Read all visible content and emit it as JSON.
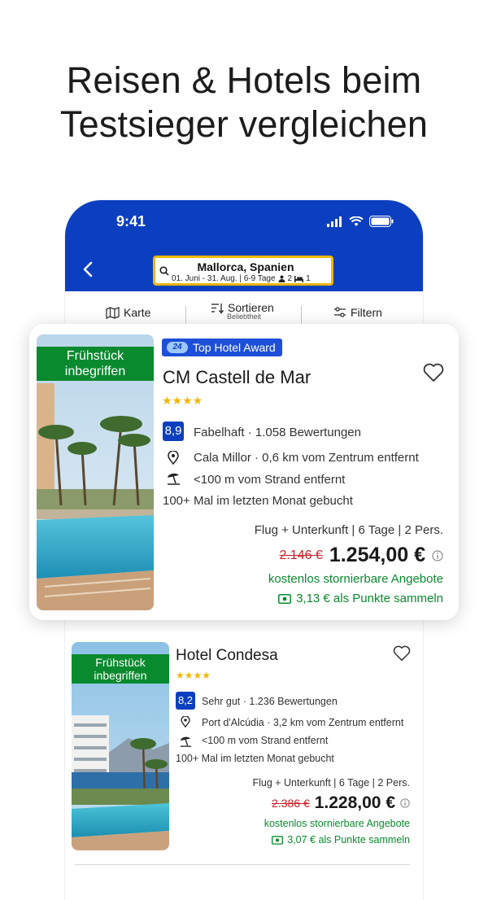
{
  "headline": {
    "line1": "Reisen & Hotels beim",
    "line2": "Testsieger vergleichen"
  },
  "status_bar": {
    "time": "9:41"
  },
  "search": {
    "destination": "Mallorca, Spanien",
    "dates": "01. Juni - 31. Aug. | 6-9 Tage",
    "persons": "2",
    "rooms": "1"
  },
  "toolbar": {
    "map": "Karte",
    "sort": "Sortieren",
    "sort_sub": "Beliebtheit",
    "filter": "Filtern"
  },
  "featured": {
    "breakfast": "Frühstück inbegriffen",
    "award": "Top Hotel Award",
    "award_logo": "24",
    "name": "CM Castell de Mar",
    "stars": "★★★★",
    "score": "8,9",
    "rating_text": "Fabelhaft · 1.058 Bewertungen",
    "location": "Cala Millor · 0,6 km vom Zentrum entfernt",
    "beach": "<100 m vom Strand entfernt",
    "booked": "100+ Mal im letzten Monat gebucht",
    "package": "Flug + Unterkunft | 6 Tage | 2 Pers.",
    "old_price": "2.146 €",
    "price": "1.254,00 €",
    "cancel": "kostenlos stornierbare Angebote",
    "points": "3,13 € als Punkte sammeln"
  },
  "second": {
    "breakfast": "Frühstück inbegriffen",
    "name": "Hotel Condesa",
    "stars": "★★★★",
    "score": "8,2",
    "rating_text": "Sehr gut · 1.236 Bewertungen",
    "location": "Port d'Alcúdia · 3,2 km vom Zentrum entfernt",
    "beach": "<100 m vom Strand entfernt",
    "booked": "100+ Mal im letzten Monat gebucht",
    "package": "Flug + Unterkunft | 6 Tage | 2 Pers.",
    "old_price": "2.386 €",
    "price": "1.228,00 €",
    "cancel": "kostenlos stornierbare Angebote",
    "points": "3,07 € als Punkte sammeln"
  },
  "colors": {
    "brand_blue": "#0c3fbf",
    "accent_yellow": "#f2b705",
    "green": "#0a8a2e",
    "price_red": "#d0202a"
  }
}
